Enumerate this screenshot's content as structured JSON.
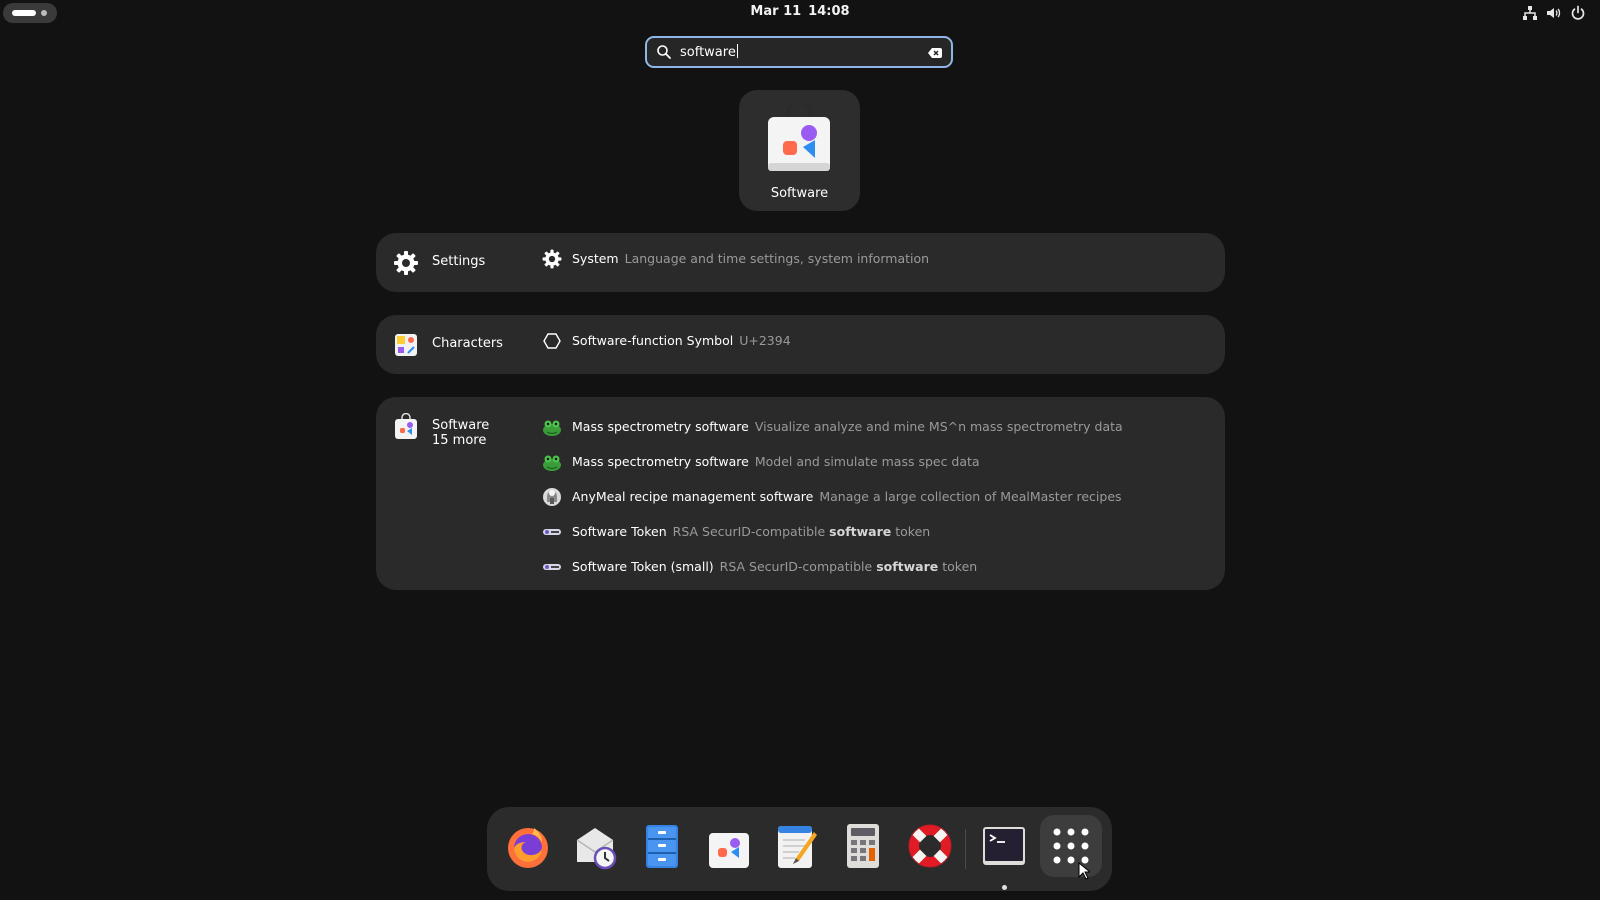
{
  "topbar": {
    "date": "Mar 11",
    "time": "14:08",
    "tray_icons": [
      "network-icon",
      "volume-icon",
      "power-icon"
    ]
  },
  "search": {
    "value": "software",
    "icon": "search-icon",
    "clear_icon": "clear-icon"
  },
  "app_result": {
    "label": "Software",
    "icon": "software-app-icon"
  },
  "providers": [
    {
      "name": "Settings",
      "icon": "gear-icon",
      "results": [
        {
          "title": "System",
          "desc": "Language and time settings, system information",
          "icon": "gear-icon"
        }
      ]
    },
    {
      "name": "Characters",
      "icon": "characters-app-icon",
      "results": [
        {
          "title": "Software-function Symbol",
          "desc": "U+2394",
          "icon": "hexagon-icon"
        }
      ]
    },
    {
      "name": "Software",
      "more": "15 more",
      "icon": "software-app-icon",
      "results": [
        {
          "title": "Mass spectrometry software",
          "desc": "Visualize analyze and mine MS^n mass spectrometry data",
          "icon": "green-frog-icon"
        },
        {
          "title": "Mass spectrometry software",
          "desc": "Model and simulate mass spec data",
          "icon": "green-frog-icon"
        },
        {
          "title": "AnyMeal recipe management software",
          "desc": "Manage a large collection of MealMaster recipes",
          "icon": "chef-icon"
        },
        {
          "title": "Software Token",
          "desc_before": "RSA SecurID-compatible",
          "desc_bold": "software",
          "desc_after": "token",
          "icon": "token-icon"
        },
        {
          "title": "Software Token (small)",
          "desc_before": "RSA SecurID-compatible",
          "desc_bold": "software",
          "desc_after": "token",
          "icon": "token-icon"
        }
      ]
    }
  ],
  "dash": {
    "items": [
      "firefox-icon",
      "mail-clock-icon",
      "files-icon",
      "software-icon",
      "text-editor-icon",
      "calculator-icon",
      "help-lifebuoy-icon",
      "terminal-icon",
      "show-apps-icon"
    ],
    "running": "terminal-icon"
  },
  "colors": {
    "background": "#121212",
    "panel": "#2a2a2a",
    "search_focus": "#8fb7e6",
    "dimmed_text": "#9a9a9a"
  }
}
